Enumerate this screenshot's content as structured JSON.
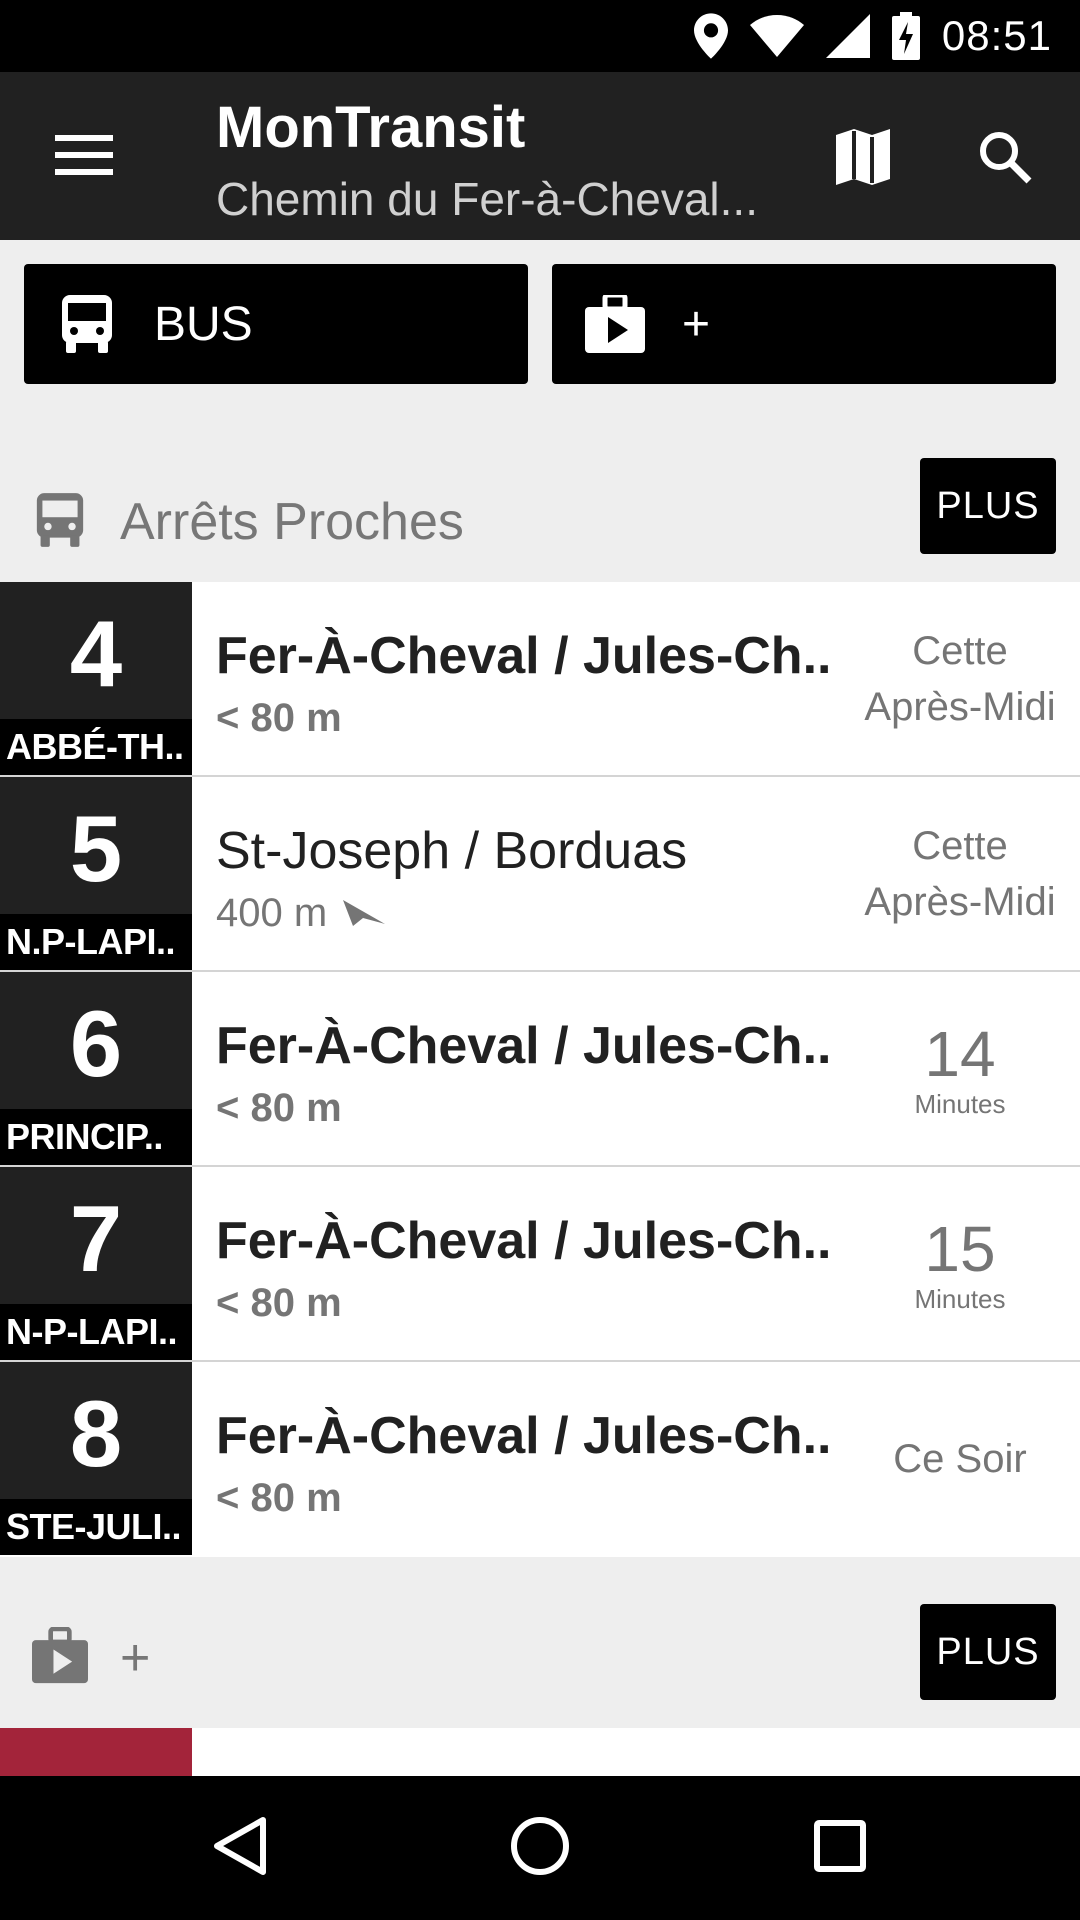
{
  "status_bar": {
    "time": "08:51",
    "icons": [
      "location-icon",
      "wifi-icon",
      "signal-icon",
      "battery-charging-icon"
    ]
  },
  "app_bar": {
    "title": "MonTransit",
    "subtitle": "Chemin du Fer-à-Cheval..."
  },
  "agency_buttons": [
    {
      "label": "BUS",
      "icon": "bus-icon"
    },
    {
      "label": "+",
      "icon": "store-icon"
    }
  ],
  "nearby_section": {
    "title": "Arrêts Proches",
    "more_label": "PLUS"
  },
  "stops": [
    {
      "route": "4",
      "direction": "ABBÉ-TH..",
      "name": "Fer-À-Cheval / Jules-Ch..",
      "distance": "< 80 m",
      "bold": true,
      "time_line1": "Cette",
      "time_line2": "Après-Midi"
    },
    {
      "route": "5",
      "direction": "N.P-LAPI..",
      "name": "St-Joseph / Borduas",
      "distance": "400 m",
      "bold": false,
      "time_line1": "Cette",
      "time_line2": "Après-Midi"
    },
    {
      "route": "6",
      "direction": "PRINCIP..",
      "name": "Fer-À-Cheval / Jules-Ch..",
      "distance": "< 80 m",
      "bold": true,
      "time_num": "14",
      "time_unit": "Minutes"
    },
    {
      "route": "7",
      "direction": "N-P-LAPI..",
      "name": "Fer-À-Cheval / Jules-Ch..",
      "distance": "< 80 m",
      "bold": true,
      "time_num": "15",
      "time_unit": "Minutes"
    },
    {
      "route": "8",
      "direction": "STE-JULI..",
      "name": "Fer-À-Cheval / Jules-Ch..",
      "distance": "< 80 m",
      "bold": true,
      "time_text": "Ce Soir"
    }
  ],
  "store_section": {
    "title": "+",
    "more_label": "PLUS"
  },
  "colors": {
    "app_bar": "#212121",
    "route_box": "#212121",
    "accent_partial": "#a3243a",
    "background": "#eeeeee"
  }
}
